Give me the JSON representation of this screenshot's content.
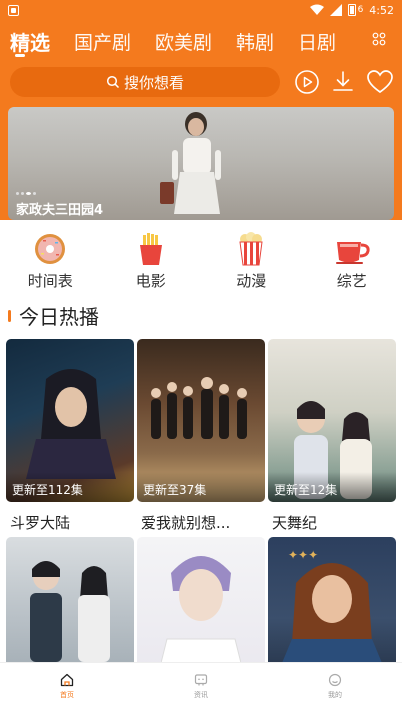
{
  "status_bar": {
    "time": "4:52",
    "battery": "6"
  },
  "tabs": [
    {
      "label": "精选",
      "active": true
    },
    {
      "label": "国产剧"
    },
    {
      "label": "欧美剧"
    },
    {
      "label": "韩剧"
    },
    {
      "label": "日剧"
    }
  ],
  "search": {
    "placeholder": "搜你想看"
  },
  "banner": {
    "title": "家政夫三田园4"
  },
  "categories": [
    {
      "label": "时间表",
      "icon": "donut-icon"
    },
    {
      "label": "电影",
      "icon": "fries-icon"
    },
    {
      "label": "动漫",
      "icon": "popcorn-icon"
    },
    {
      "label": "综艺",
      "icon": "tea-cup-icon"
    }
  ],
  "section": {
    "title": "今日热播"
  },
  "shows": [
    {
      "title": "斗罗大陆",
      "badge": "更新至112集"
    },
    {
      "title": "爱我就别想...",
      "badge": "更新至37集"
    },
    {
      "title": "天舞纪",
      "badge": "更新至12集"
    },
    {
      "title": "",
      "badge": ""
    },
    {
      "title": "",
      "badge": ""
    },
    {
      "title": "",
      "badge": ""
    }
  ],
  "bottom_nav": [
    {
      "label": "首页",
      "active": true
    },
    {
      "label": "资讯"
    },
    {
      "label": "我的"
    }
  ],
  "colors": {
    "accent": "#f47a1e"
  }
}
